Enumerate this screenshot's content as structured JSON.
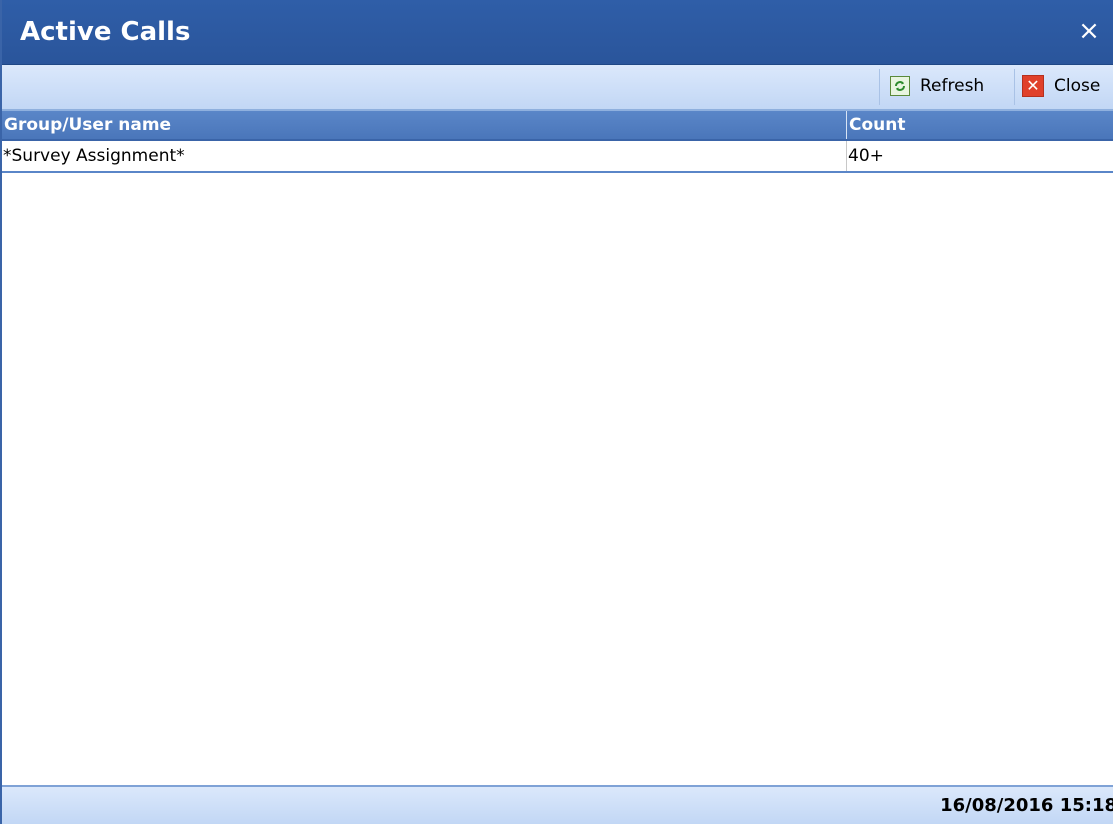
{
  "window": {
    "title": "Active Calls",
    "close_glyph": "×"
  },
  "toolbar": {
    "refresh_label": "Refresh",
    "refresh_icon": "refresh-icon",
    "close_label": "Close",
    "close_icon": "close-icon"
  },
  "grid": {
    "columns": [
      "Group/User name",
      "Count"
    ],
    "rows": [
      [
        "*Survey Assignment*",
        "40+"
      ]
    ]
  },
  "status": {
    "timestamp": "16/08/2016 15:18"
  },
  "colors": {
    "titlebar": "#2f5ea8",
    "header": "#5a86c8",
    "toolbar": "#dbe8fb",
    "close_icon": "#e0402a"
  }
}
